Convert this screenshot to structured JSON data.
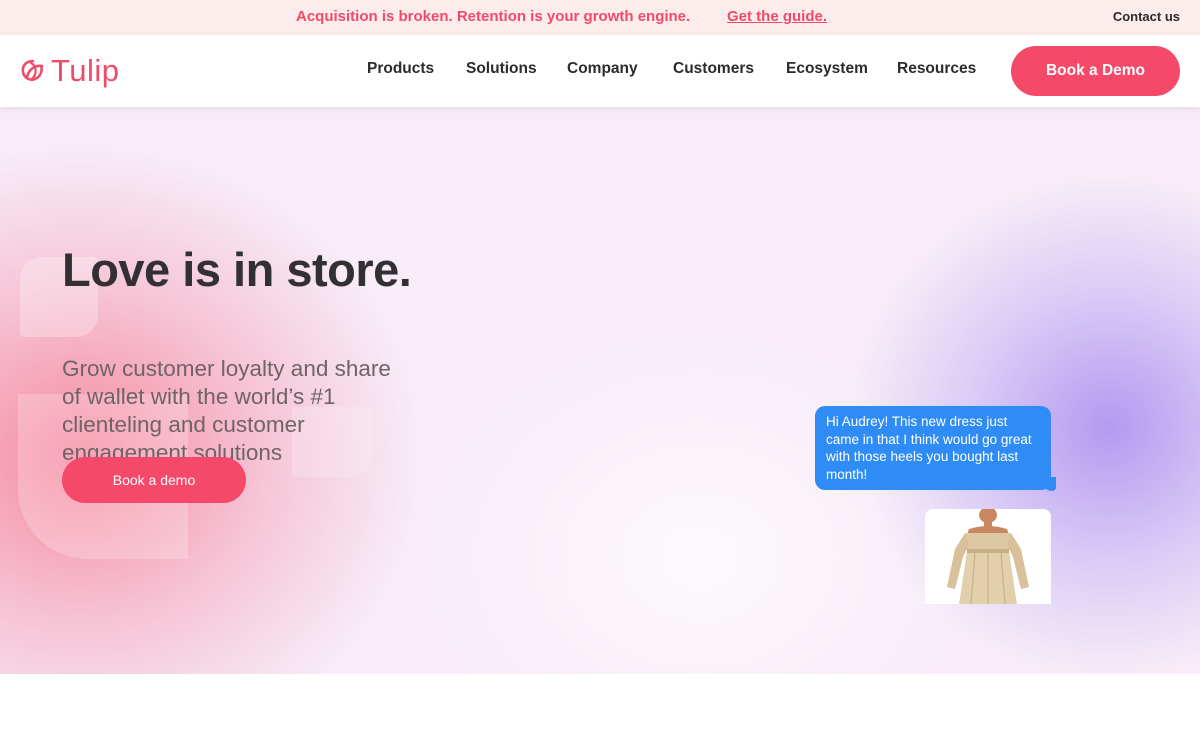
{
  "announcement": {
    "text": "Acquisition is broken. Retention is your growth engine.",
    "link_label": "Get the guide.",
    "contact_label": "Contact us"
  },
  "nav": {
    "logo_text": "Tulip",
    "items": [
      {
        "label": "Products"
      },
      {
        "label": "Solutions"
      },
      {
        "label": "Company"
      },
      {
        "label": "Customers"
      },
      {
        "label": "Ecosystem"
      },
      {
        "label": "Resources"
      }
    ],
    "cta_label": "Book a Demo"
  },
  "hero": {
    "title": "Love is in store.",
    "subtitle": "Grow customer loyalty and share of wallet with the world’s #1 clienteling and customer engagement solutions",
    "cta_label": "Book a demo",
    "message": "Hi Audrey! This new dress just came in that I think would go great with those heels you bought last month!"
  },
  "colors": {
    "brand": "#f5496a",
    "announcement_bg": "#fdecec",
    "message_bubble": "#2f8cf7",
    "heading": "#333033"
  }
}
